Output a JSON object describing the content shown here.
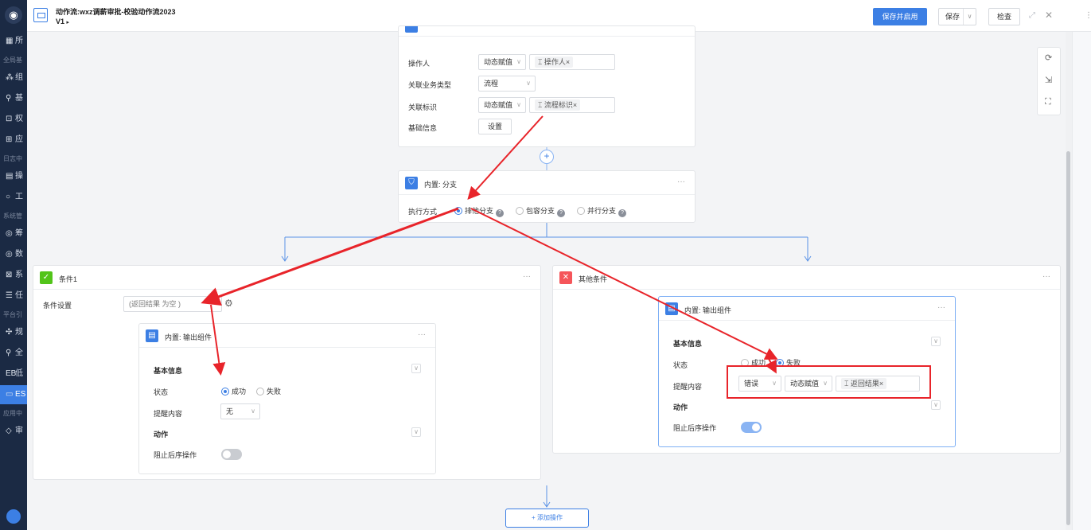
{
  "colors": {
    "accent": "#3c7fe4",
    "annotation_red": "#e8242a",
    "sidebar_bg": "#1b2a44",
    "success": "#52c41a",
    "danger": "#f5555a"
  },
  "header": {
    "title": "动作流:wxz调薪审批-校验动作流2023",
    "version": "V1",
    "version_caret": "▸",
    "save_enable_label": "保存并启用",
    "save_label": "保存",
    "save_caret": "∨",
    "check_label": "检查"
  },
  "sidebar": {
    "items": [
      {
        "glyph": "▦",
        "label": "所"
      },
      {
        "glyph": "",
        "label": "全局基",
        "group": true
      },
      {
        "glyph": "⁂",
        "label": "组"
      },
      {
        "glyph": "⚲",
        "label": "基"
      },
      {
        "glyph": "⊡",
        "label": "权"
      },
      {
        "glyph": "⊞",
        "label": "应"
      },
      {
        "glyph": "",
        "label": "日志中",
        "group": true
      },
      {
        "glyph": "▤",
        "label": "操"
      },
      {
        "glyph": "○",
        "label": "工"
      },
      {
        "glyph": "",
        "label": "系统管",
        "group": true
      },
      {
        "glyph": "◎",
        "label": "筹"
      },
      {
        "glyph": "◎",
        "label": "数"
      },
      {
        "glyph": "⊠",
        "label": "系"
      },
      {
        "glyph": "☰",
        "label": "任"
      },
      {
        "glyph": "",
        "label": "平台引",
        "group": true
      },
      {
        "glyph": "✣",
        "label": "规"
      },
      {
        "glyph": "⚲",
        "label": "全"
      },
      {
        "glyph": "EB",
        "label": "低"
      },
      {
        "glyph": "▭",
        "label": "ES",
        "active": true
      },
      {
        "glyph": "",
        "label": "应用中",
        "group": true
      },
      {
        "glyph": "◇",
        "label": "审"
      }
    ]
  },
  "top_node": {
    "rows": [
      {
        "label": "操作人",
        "select": "动态赋值",
        "tag": "操作人"
      },
      {
        "label": "关联业务类型",
        "select": "流程"
      },
      {
        "label": "关联标识",
        "select": "动态赋值",
        "tag": "流程标识"
      },
      {
        "label": "基础信息",
        "button": "设置"
      }
    ]
  },
  "branch_node": {
    "title": "内置: 分支",
    "exec_label": "执行方式",
    "options": [
      {
        "label": "排他分支",
        "selected": true
      },
      {
        "label": "包容分支",
        "selected": false
      },
      {
        "label": "并行分支",
        "selected": false
      }
    ],
    "help": "?"
  },
  "condition1": {
    "title": "条件1",
    "setting_label": "条件设置",
    "condition_value": "(返回结果 为空 )",
    "output": {
      "title": "内置: 输出组件",
      "basic_info": "基本信息",
      "status_label": "状态",
      "status_options": [
        {
          "label": "成功",
          "selected": true
        },
        {
          "label": "失败",
          "selected": false
        }
      ],
      "prompt_label": "提醒内容",
      "prompt_value": "无",
      "action_label": "动作",
      "block_label": "阻止后序操作",
      "block_on": false
    }
  },
  "other_condition": {
    "title": "其他条件",
    "output": {
      "title": "内置: 输出组件",
      "basic_info": "基本信息",
      "status_label": "状态",
      "status_options": [
        {
          "label": "成功",
          "selected": false
        },
        {
          "label": "失败",
          "selected": true
        }
      ],
      "prompt_label": "提醒内容",
      "prompt_type": "错误",
      "prompt_select": "动态赋值",
      "prompt_tag": "返回结果",
      "action_label": "动作",
      "block_label": "阻止后序操作",
      "block_on": true
    }
  },
  "add_action_label": "+ 添加操作",
  "icons": {
    "more": "···",
    "close_tag": "×",
    "chevron": "∨",
    "plus": "+",
    "gear": "⚙",
    "refresh": "⟳",
    "layout": "⇲",
    "fit": "⛶"
  }
}
